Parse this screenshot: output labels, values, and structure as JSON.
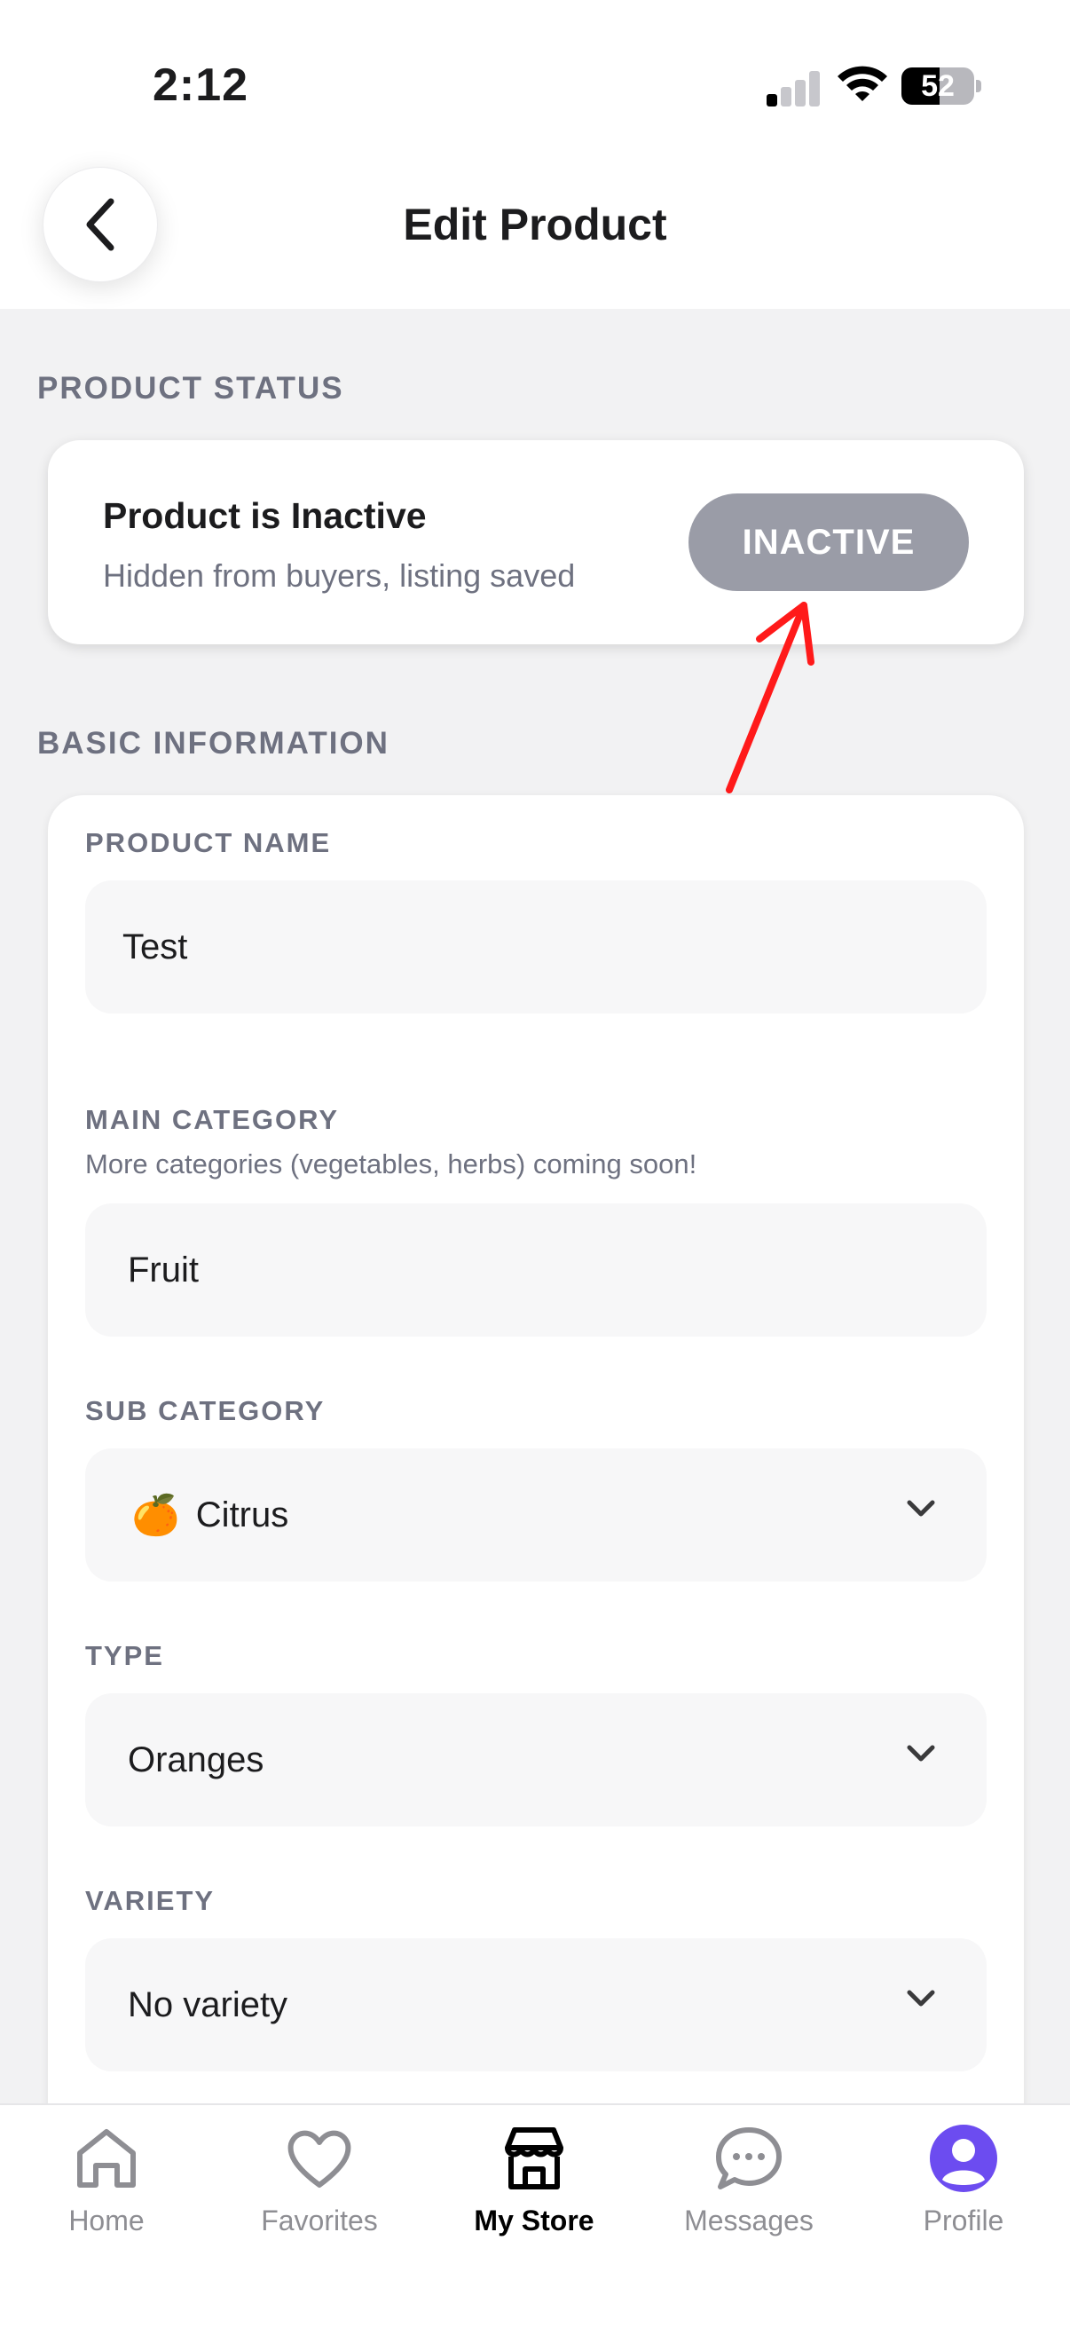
{
  "status_bar": {
    "time": "2:12",
    "battery": "52"
  },
  "header": {
    "title": "Edit Product"
  },
  "product_status": {
    "section_label": "PRODUCT STATUS",
    "title": "Product is Inactive",
    "subtitle": "Hidden from buyers, listing saved",
    "badge": "INACTIVE"
  },
  "basic_info": {
    "section_label": "BASIC INFORMATION",
    "product_name": {
      "label": "PRODUCT NAME",
      "value": "Test"
    },
    "main_category": {
      "label": "MAIN CATEGORY",
      "help": "More categories (vegetables, herbs) coming soon!",
      "value": "Fruit"
    },
    "sub_category": {
      "label": "SUB CATEGORY",
      "emoji": "🍊",
      "value": "Citrus"
    },
    "type": {
      "label": "TYPE",
      "value": "Oranges"
    },
    "variety": {
      "label": "VARIETY",
      "value": "No variety"
    }
  },
  "tabbar": {
    "items": [
      {
        "label": "Home",
        "icon": "home-icon"
      },
      {
        "label": "Favorites",
        "icon": "heart-icon"
      },
      {
        "label": "My Store",
        "icon": "store-icon",
        "active": true
      },
      {
        "label": "Messages",
        "icon": "chat-icon"
      },
      {
        "label": "Profile",
        "icon": "avatar-icon"
      }
    ]
  },
  "colors": {
    "accent_profile": "#6c4cf0",
    "badge_inactive": "#9a9ca7",
    "annotation_arrow": "#ff1a1a"
  }
}
